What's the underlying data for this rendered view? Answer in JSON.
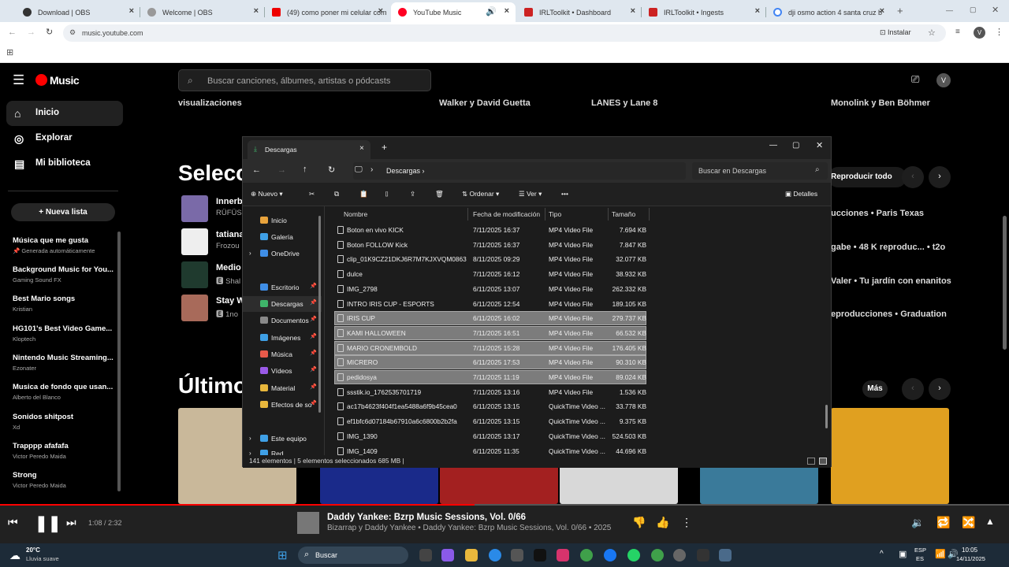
{
  "browser": {
    "tabs": [
      {
        "title": "Download | OBS",
        "color": "#333"
      },
      {
        "title": "Welcome | OBS",
        "color": "#999"
      },
      {
        "title": "(49) como poner mi celular com",
        "color": "#e00"
      },
      {
        "title": "YouTube Music",
        "color": "#f02"
      },
      {
        "title": "IRLToolkit • Dashboard",
        "color": "#c22"
      },
      {
        "title": "IRLToolkit • Ingests",
        "color": "#c22"
      },
      {
        "title": "dji osmo action 4 santa cruz b",
        "color": "#4285f4"
      }
    ],
    "new_tab": "+",
    "url": "music.youtube.com",
    "install_label": "Instalar",
    "profile_initial": "V"
  },
  "yt": {
    "logo": "Music",
    "search_placeholder": "Buscar canciones, álbumes, artistas o pódcasts",
    "avatar": "V",
    "nav": [
      {
        "label": "Inicio",
        "icon": "⌂"
      },
      {
        "label": "Explorar",
        "icon": "◎"
      },
      {
        "label": "Mi biblioteca",
        "icon": "▤"
      }
    ],
    "new_list": "Nueva lista",
    "playlists": [
      {
        "title": "Música que me gusta",
        "sub": "📌 Generada automáticamente"
      },
      {
        "title": "Background Music for You...",
        "sub": "Gaming Sound FX"
      },
      {
        "title": "Best Mario songs",
        "sub": "Kristian"
      },
      {
        "title": "HG101's Best Video Game...",
        "sub": "Kloptech"
      },
      {
        "title": "Nintendo Music Streaming...",
        "sub": "Ezonater"
      },
      {
        "title": "Musica de fondo que usan...",
        "sub": "Alberto del Blanco"
      },
      {
        "title": "Sonidos shitpost",
        "sub": "Xd"
      },
      {
        "title": "Trapppp afafafa",
        "sub": "Victor Peredo Maida"
      },
      {
        "title": "Strong",
        "sub": "Victor Peredo Maida"
      }
    ],
    "top_row": [
      "visualizaciones",
      "Walker y David Guetta",
      "LANES y Lane 8",
      "Monolink y Ben Böhmer"
    ],
    "section1_title": "Selecc",
    "section2_title": "Últimos",
    "play_all": "Reproducir todo",
    "more": "Más",
    "songs": [
      {
        "title": "Innerbl",
        "sub": "RÜFÜS"
      },
      {
        "title": "tatiana",
        "sub": "Frozou"
      },
      {
        "title": "Medio",
        "sub": "🅴 Shal"
      },
      {
        "title": "Stay W",
        "sub": "🅴 1no"
      }
    ],
    "right_rows": [
      "ucciones • Paris Texas",
      "gabe • 48 K reproduc... • t2o",
      "Valer • Tu jardín con enanitos",
      "eproducciones • Graduation"
    ]
  },
  "explorer": {
    "tab_title": "Descargas",
    "breadcrumb": "Descargas",
    "search_placeholder": "Buscar en Descargas",
    "commands": {
      "new": "Nuevo",
      "sort": "Ordenar",
      "view": "Ver",
      "more": "•••",
      "details": "Detalles"
    },
    "sidebar": [
      {
        "label": "Inicio",
        "color": "#e8a33c",
        "pin": false
      },
      {
        "label": "Galería",
        "color": "#3fa0e6",
        "pin": false
      },
      {
        "label": "OneDrive",
        "color": "#3f8ee6",
        "pin": false
      },
      {
        "label": "Escritorio",
        "color": "#3f8ee6",
        "pin": true
      },
      {
        "label": "Descargas",
        "color": "#3fb56a",
        "pin": true
      },
      {
        "label": "Documentos",
        "color": "#8a8a8a",
        "pin": true
      },
      {
        "label": "Imágenes",
        "color": "#3fa0e6",
        "pin": true
      },
      {
        "label": "Música",
        "color": "#e85a4a",
        "pin": true
      },
      {
        "label": "Vídeos",
        "color": "#9a5ae8",
        "pin": true
      },
      {
        "label": "Material",
        "color": "#e8b73c",
        "pin": true
      },
      {
        "label": "Efectos de so",
        "color": "#e8b73c",
        "pin": true
      },
      {
        "label": "Este equipo",
        "color": "#3fa0e6",
        "pin": false
      },
      {
        "label": "Red",
        "color": "#3fa0e6",
        "pin": false
      }
    ],
    "columns": [
      "Nombre",
      "Fecha de modificación",
      "Tipo",
      "Tamaño"
    ],
    "files": [
      {
        "name": "Boton en vivo KICK",
        "date": "7/11/2025 16:37",
        "type": "MP4 Video File",
        "size": "7.694 KB",
        "sel": false
      },
      {
        "name": "Boton FOLLOW Kick",
        "date": "7/11/2025 16:37",
        "type": "MP4 Video File",
        "size": "7.847 KB",
        "sel": false
      },
      {
        "name": "clip_01K9CZ21DKJ6R7M7KJXVQM0863",
        "date": "8/11/2025 09:29",
        "type": "MP4 Video File",
        "size": "32.077 KB",
        "sel": false
      },
      {
        "name": "dulce",
        "date": "7/11/2025 16:12",
        "type": "MP4 Video File",
        "size": "38.932 KB",
        "sel": false
      },
      {
        "name": "IMG_2798",
        "date": "6/11/2025 13:07",
        "type": "MP4 Video File",
        "size": "262.332 KB",
        "sel": false
      },
      {
        "name": "INTRO IRIS CUP - ESPORTS",
        "date": "6/11/2025 12:54",
        "type": "MP4 Video File",
        "size": "189.105 KB",
        "sel": false
      },
      {
        "name": "IRIS CUP",
        "date": "6/11/2025 16:02",
        "type": "MP4 Video File",
        "size": "279.737 KB",
        "sel": true
      },
      {
        "name": "KAMI HALLOWEEN",
        "date": "7/11/2025 16:51",
        "type": "MP4 Video File",
        "size": "66.532 KB",
        "sel": true
      },
      {
        "name": "MARIO CRONEMBOLD",
        "date": "7/11/2025 15:28",
        "type": "MP4 Video File",
        "size": "176.405 KB",
        "sel": true
      },
      {
        "name": "MICRERO",
        "date": "6/11/2025 17:53",
        "type": "MP4 Video File",
        "size": "90.310 KB",
        "sel": true
      },
      {
        "name": "pedidosya",
        "date": "7/11/2025 11:19",
        "type": "MP4 Video File",
        "size": "89.024 KB",
        "sel": true
      },
      {
        "name": "ssstik.io_1762535701719",
        "date": "7/11/2025 13:16",
        "type": "MP4 Video File",
        "size": "1.536 KB",
        "sel": false
      },
      {
        "name": "ac17b4623f404f1ea5488a6f9b45cea0",
        "date": "6/11/2025 13:15",
        "type": "QuickTime Video ...",
        "size": "33.778 KB",
        "sel": false
      },
      {
        "name": "ef1bfc6d07184b67910a6c6800b2b2fa",
        "date": "6/11/2025 13:15",
        "type": "QuickTime Video ...",
        "size": "9.375 KB",
        "sel": false
      },
      {
        "name": "IMG_1390",
        "date": "6/11/2025 13:17",
        "type": "QuickTime Video ...",
        "size": "524.503 KB",
        "sel": false
      },
      {
        "name": "IMG_1409",
        "date": "6/11/2025 11:35",
        "type": "QuickTime Video ...",
        "size": "44.696 KB",
        "sel": false
      }
    ],
    "status_count": "141 elementos",
    "status_selected": "5 elementos seleccionados 685 MB"
  },
  "player": {
    "time": "1:08 / 2:32",
    "progress": 0.47,
    "title": "Daddy Yankee: Bzrp Music Sessions, Vol. 0/66",
    "sub": "Bizarrap y Daddy Yankee • Daddy Yankee: Bzrp Music Sessions, Vol. 0/66 • 2025"
  },
  "taskbar": {
    "weather_temp": "20°C",
    "weather_desc": "Lluvia suave",
    "search": "Buscar",
    "lang1": "ESP",
    "lang2": "ES",
    "time": "10:05",
    "date": "14/11/2025"
  }
}
